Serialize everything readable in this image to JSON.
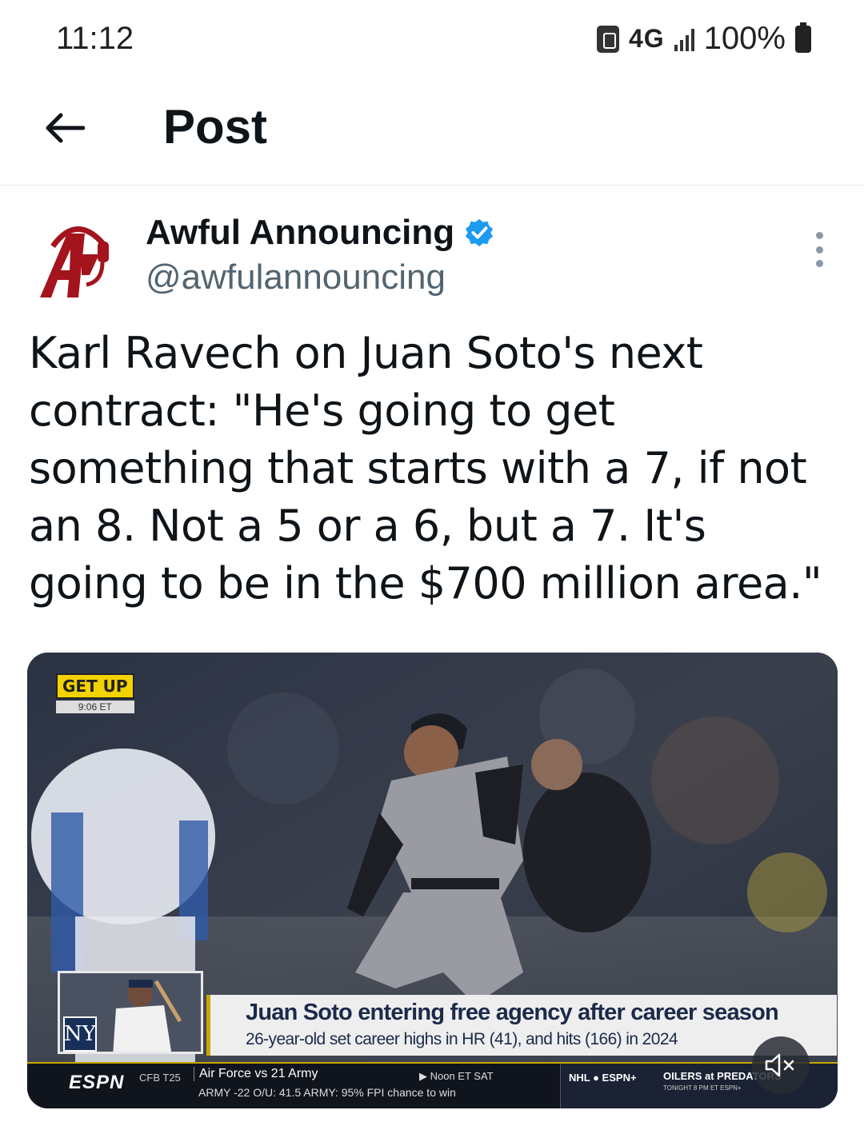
{
  "status_bar": {
    "time": "11:12",
    "network": "4G",
    "battery": "100%"
  },
  "header": {
    "title": "Post",
    "back_icon": "arrow-left-icon"
  },
  "post": {
    "author_name": "Awful Announcing",
    "author_handle": "@awfulannouncing",
    "verified_color": "#1d9bf0",
    "avatar_color": "#a3141c",
    "text": "Karl Ravech on Juan Soto's next contract: \"He's going to get something that starts with a 7, if not an 8. Not a 5 or a 6, but a 7. It's going to be in the $700 million area.\""
  },
  "media": {
    "show_logo_title": "GET UP",
    "show_logo_time": "9:06 ET",
    "headline": "Juan Soto entering free agency after career season",
    "subheadline": "26-year-old set career highs in HR (41), and hits (166) in 2024",
    "team_logo_text": "NY",
    "ticker": {
      "network": "ESPN",
      "label": "CFB T25",
      "game": "Air Force vs 21 Army",
      "line": "ARMY -22   O/U: 41.5   ARMY: 95% FPI chance to win",
      "when": "▶ Noon ET SAT",
      "nhl": "NHL ● ESPN+",
      "teams": "OILERS at PREDATORS",
      "tonight": "TONIGHT 8 PM ET ESPN+"
    },
    "mute_icon": "speaker-muted-icon"
  }
}
